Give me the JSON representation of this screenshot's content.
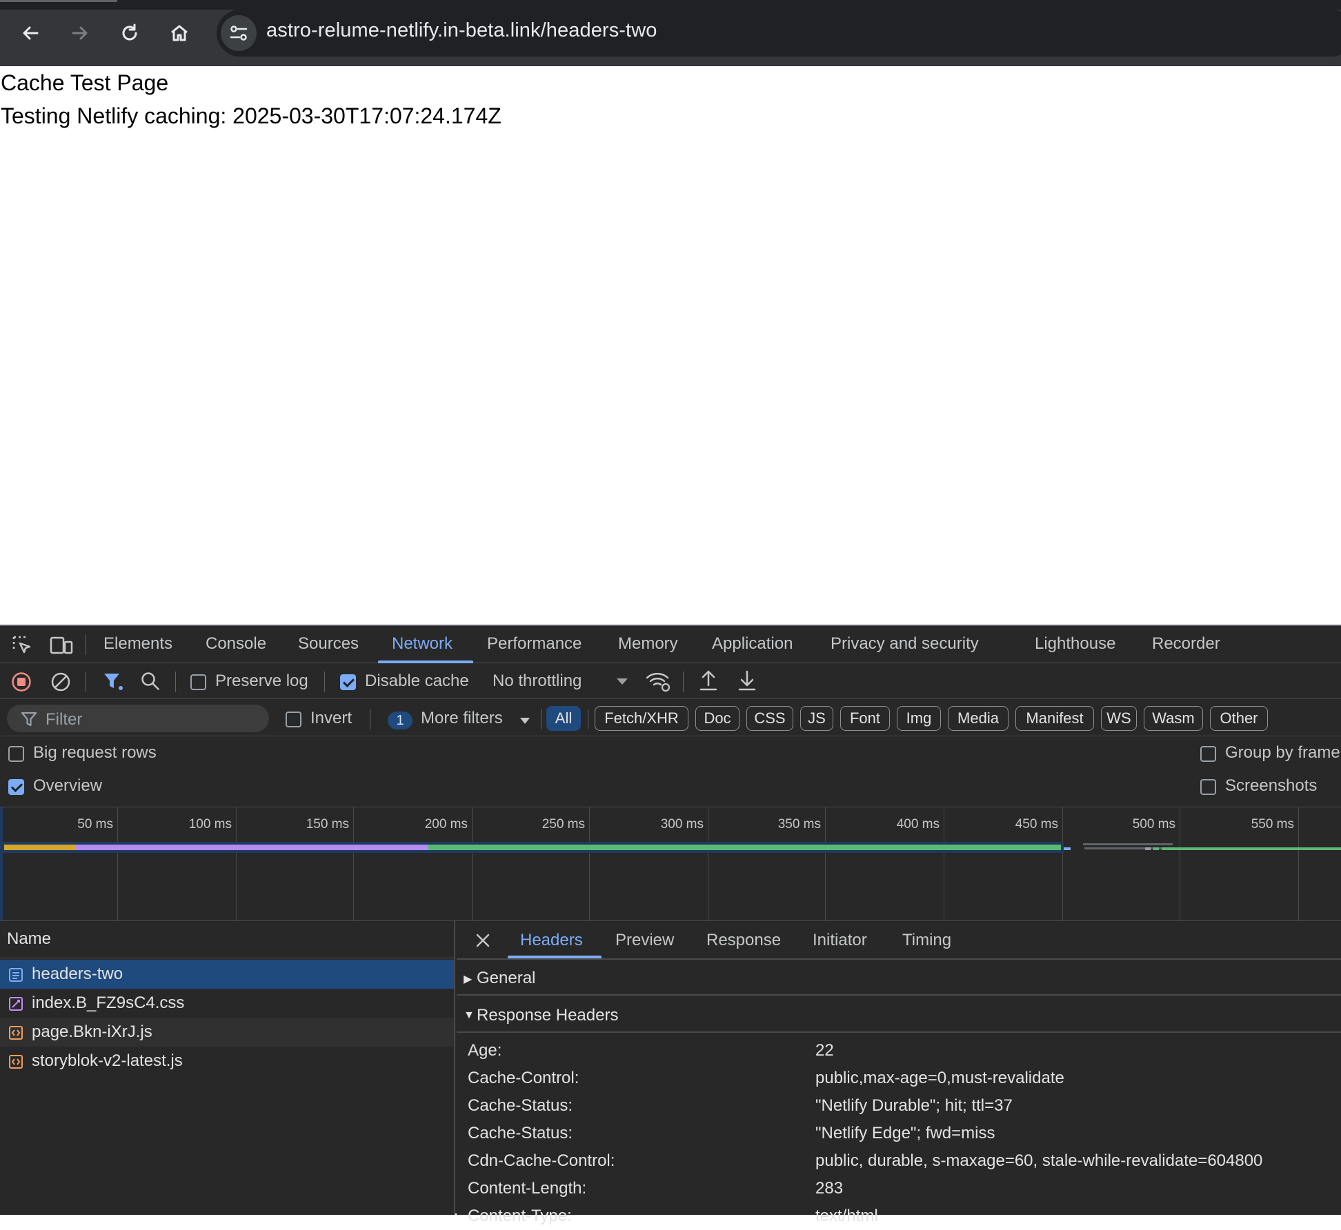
{
  "browser": {
    "url": "astro-relume-netlify.in-beta.link/headers-two"
  },
  "page": {
    "heading": "Cache Test Page",
    "timestamp_line": "Testing Netlify caching: 2025-03-30T17:07:24.174Z"
  },
  "devtools": {
    "tabs": [
      "Elements",
      "Console",
      "Sources",
      "Network",
      "Performance",
      "Memory",
      "Application",
      "Privacy and security",
      "Lighthouse",
      "Recorder"
    ],
    "active_tab": "Network",
    "toolbar": {
      "preserve_log": "Preserve log",
      "preserve_log_checked": false,
      "disable_cache": "Disable cache",
      "disable_cache_checked": true,
      "throttling": "No throttling"
    },
    "filterbar": {
      "filter_placeholder": "Filter",
      "invert": "Invert",
      "more_filters_count": "1",
      "more_filters": "More filters",
      "type_chips": [
        "All",
        "Fetch/XHR",
        "Doc",
        "CSS",
        "JS",
        "Font",
        "Img",
        "Media",
        "Manifest",
        "WS",
        "Wasm",
        "Other"
      ],
      "active_chip": "All"
    },
    "options": {
      "big_request_rows": "Big request rows",
      "big_request_rows_checked": false,
      "overview": "Overview",
      "overview_checked": true,
      "group_by_frame": "Group by frame",
      "group_by_frame_checked": false,
      "screenshots": "Screenshots",
      "screenshots_checked": false
    },
    "overview_ticks": [
      "50 ms",
      "100 ms",
      "150 ms",
      "200 ms",
      "250 ms",
      "300 ms",
      "350 ms",
      "400 ms",
      "450 ms",
      "500 ms",
      "550 ms"
    ],
    "overview_colors": {
      "queueing": "#d4a72c",
      "waiting": "#b48cf2",
      "download": "#5bb974",
      "track": "#1f3a5f"
    },
    "requests": {
      "column_header": "Name",
      "items": [
        {
          "name": "headers-two",
          "type": "doc-icon",
          "selected": true
        },
        {
          "name": "index.B_FZ9sC4.css",
          "type": "css-icon",
          "selected": false
        },
        {
          "name": "page.Bkn-iXrJ.js",
          "type": "script-icon",
          "selected": false
        },
        {
          "name": "storyblok-v2-latest.js",
          "type": "script-icon",
          "selected": false
        }
      ]
    },
    "detail": {
      "tabs": [
        "Headers",
        "Preview",
        "Response",
        "Initiator",
        "Timing"
      ],
      "active_tab": "Headers",
      "general_label": "General",
      "response_headers_label": "Response Headers",
      "response_headers": [
        {
          "key": "Age:",
          "value": "22"
        },
        {
          "key": "Cache-Control:",
          "value": "public,max-age=0,must-revalidate"
        },
        {
          "key": "Cache-Status:",
          "value": "\"Netlify Durable\"; hit; ttl=37"
        },
        {
          "key": "Cache-Status:",
          "value": "\"Netlify Edge\"; fwd=miss"
        },
        {
          "key": "Cdn-Cache-Control:",
          "value": "public, durable, s-maxage=60, stale-while-revalidate=604800"
        },
        {
          "key": "Content-Length:",
          "value": "283"
        },
        {
          "key": "Content-Type:",
          "value": "text/html"
        }
      ]
    }
  }
}
